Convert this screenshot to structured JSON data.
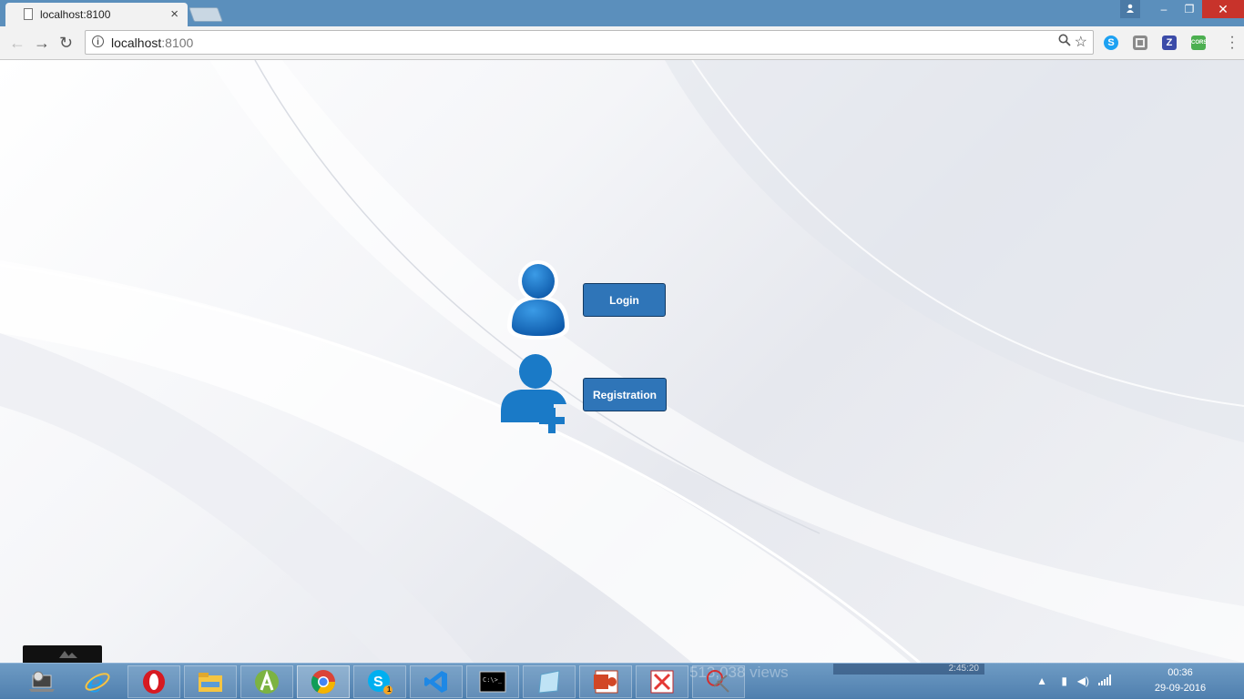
{
  "browser": {
    "tab_title": "localhost:8100",
    "tab_close": "×",
    "url_host": "localhost",
    "url_port": ":8100",
    "window_controls": {
      "minimize": "–",
      "restore": "❐",
      "close": "✕"
    },
    "nav": {
      "back": "←",
      "forward": "→",
      "reload": "↻"
    },
    "extensions": [
      "skype-extension-icon",
      "evernote-extension-icon",
      "zotero-extension-icon",
      "cors-extension-icon"
    ],
    "ext_labels": {
      "zotero": "Z",
      "cors": "CORS"
    }
  },
  "page": {
    "login_label": "Login",
    "registration_label": "Registration",
    "icon_color": "#1a6fbf",
    "button_color": "#2f75b8"
  },
  "taskbar": {
    "apps": [
      "settings-laptop-icon",
      "internet-explorer-icon",
      "opera-icon",
      "file-explorer-icon",
      "android-studio-icon",
      "chrome-icon",
      "skype-icon",
      "visual-studio-code-icon",
      "command-prompt-icon",
      "notepad-icon",
      "powerpoint-icon",
      "xampp-icon",
      "snipping-tool-icon"
    ],
    "skype_badge": "1",
    "clock_time": "00:36",
    "clock_date": "29-09-2016",
    "ghost_views": "513,038 views",
    "ghost_duration": "2:45:20"
  }
}
